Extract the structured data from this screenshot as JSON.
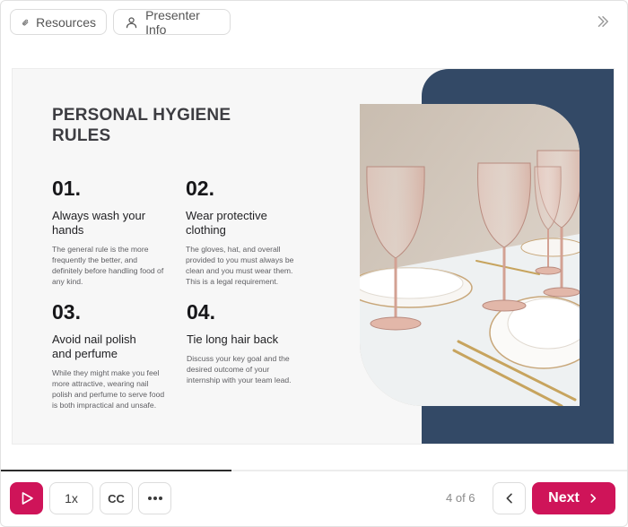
{
  "topbar": {
    "resources_label": "Resources",
    "presenter_label": "Presenter Info"
  },
  "slide": {
    "title": "PERSONAL HYGIENE RULES",
    "rules": [
      {
        "num": "01.",
        "heading": "Always wash your hands",
        "description": "The general rule is the more frequently the better, and definitely before handling food of any kind."
      },
      {
        "num": "02.",
        "heading": "Wear protective clothing",
        "description": "The gloves, hat, and overall provided to you must always be clean and you must wear them. This is a legal requirement."
      },
      {
        "num": "03.",
        "heading": "Avoid nail polish and perfume",
        "description": "While they might make you feel more attractive, wearing nail polish and perfume to serve food is both impractical and unsafe."
      },
      {
        "num": "04.",
        "heading": "Tie long hair back",
        "description": "Discuss your key goal and the desired outcome of your internship with your team lead."
      }
    ]
  },
  "progress": {
    "fraction": 0.367
  },
  "bottombar": {
    "speed_label": "1x",
    "cc_label": "CC",
    "page_indicator": "4 of 6",
    "next_label": "Next"
  },
  "colors": {
    "accent": "#cf1459",
    "navy": "#334966"
  },
  "icons": {
    "resources": "paperclip-icon",
    "presenter": "person-icon",
    "collapse": "double-chevron-right-icon",
    "play": "play-icon",
    "more": "ellipsis-icon",
    "prev": "chevron-left-icon",
    "next": "chevron-right-icon"
  }
}
